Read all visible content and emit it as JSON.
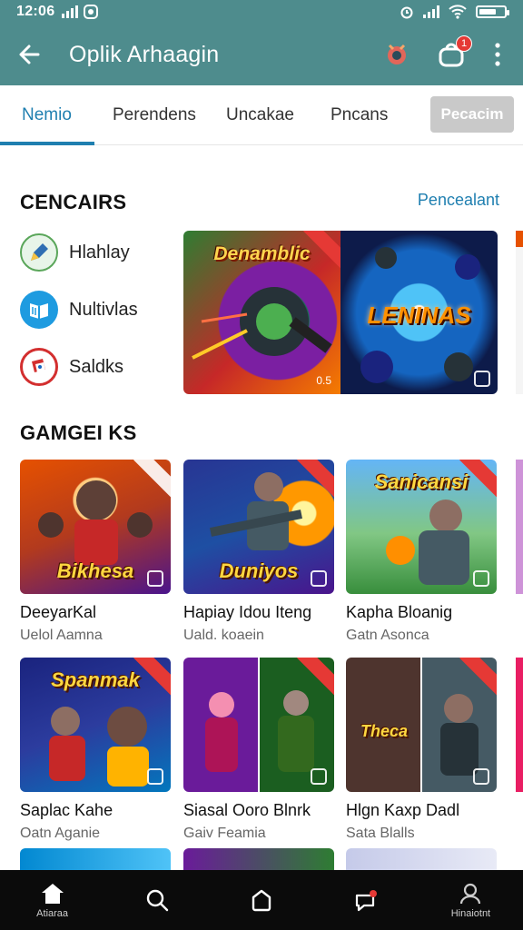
{
  "status": {
    "time": "12:06"
  },
  "appbar": {
    "title": "Oplik Arhaagin",
    "notif_count": "1"
  },
  "tabs": [
    {
      "label": "Nemio",
      "active": true
    },
    {
      "label": "Perendens",
      "active": false
    },
    {
      "label": "Uncakae",
      "active": false
    },
    {
      "label": "Pncans",
      "active": false
    }
  ],
  "tab_button": "Pecacim",
  "sections": {
    "categories_title": "CENCAIRS",
    "categories_link": "Pencealant",
    "games_title": "GAMGEI KS"
  },
  "categories": [
    {
      "label": "Hlahlay",
      "icon": "pencil-icon"
    },
    {
      "label": "Nultivlas",
      "icon": "book-icon"
    },
    {
      "label": "Saldks",
      "icon": "cards-icon"
    }
  ],
  "feature": {
    "left_title": "Denamblic",
    "right_title": "LENINAS",
    "left_stamp": "0.5"
  },
  "games": [
    {
      "title": "DeeyarKal",
      "subtitle": "Uelol Aamna",
      "art": "Bikhesa",
      "bg": "#b23a1e",
      "accent": "#ff8f00"
    },
    {
      "title": "Hapiay Idou Iteng",
      "subtitle": "Uald. koaein",
      "art": "Duniyos",
      "bg": "#1e4fa3",
      "accent": "#ffb300"
    },
    {
      "title": "Kapha Bloanig",
      "subtitle": "Gatn Asonca",
      "art": "Sanicansi",
      "bg": "#3f8f3a",
      "accent": "#8bc34a"
    },
    {
      "title": "Saplac Kahe",
      "subtitle": "Oatn Aganie",
      "art": "Spanmak",
      "bg": "#2c3c9e",
      "accent": "#ff6f00"
    },
    {
      "title": "Siasal Ooro Blnrk",
      "subtitle": "Gaiv Feamia",
      "art": "",
      "bg": "#7a2a8c",
      "accent": "#2e7d32"
    },
    {
      "title": "Hlgn Kaxp Dadl",
      "subtitle": "Sata Blalls",
      "art": "Theca",
      "bg": "#5d2c1e",
      "accent": "#546e7a"
    }
  ],
  "bottom_nav": [
    {
      "label": "Atiaraa",
      "icon": "home-icon"
    },
    {
      "label": "",
      "icon": "search-icon"
    },
    {
      "label": "",
      "icon": "bag-icon"
    },
    {
      "label": "",
      "icon": "chat-icon"
    },
    {
      "label": "Hinaiotnt",
      "icon": "profile-icon"
    }
  ],
  "colors": {
    "primary": "#4e8c8d",
    "accent": "#1f7fb0",
    "nav_bg": "#0b0b0b"
  }
}
